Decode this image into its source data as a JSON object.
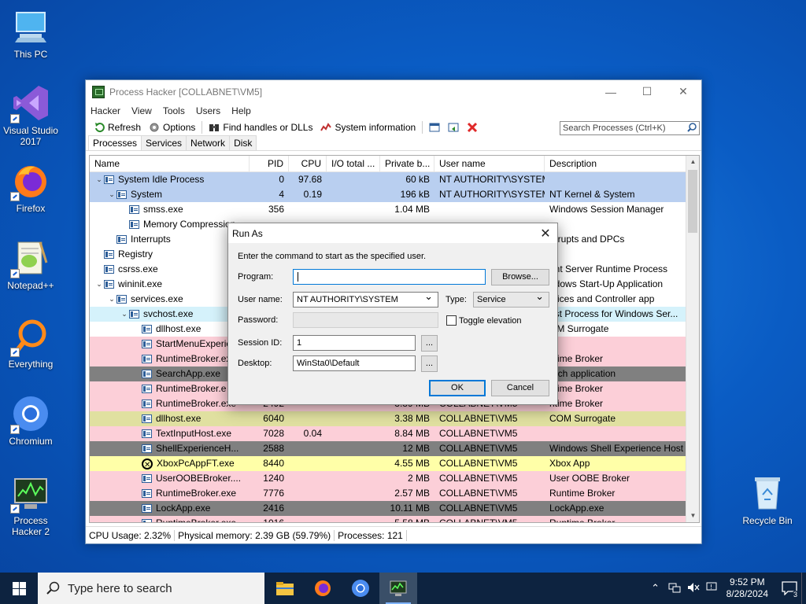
{
  "desktop": {
    "icons": [
      {
        "label": "This PC",
        "icon": "this-pc-icon"
      },
      {
        "label": "Visual Studio 2017",
        "icon": "visual-studio-icon"
      },
      {
        "label": "Firefox",
        "icon": "firefox-icon"
      },
      {
        "label": "Notepad++",
        "icon": "notepadpp-icon"
      },
      {
        "label": "Everything",
        "icon": "everything-icon"
      },
      {
        "label": "Chromium",
        "icon": "chromium-icon"
      },
      {
        "label": "Process Hacker 2",
        "icon": "process-hacker-icon"
      },
      {
        "label": "Recycle Bin",
        "icon": "recycle-bin-icon"
      }
    ]
  },
  "window": {
    "title": "Process Hacker [COLLABNET\\VM5]",
    "menu": [
      "Hacker",
      "View",
      "Tools",
      "Users",
      "Help"
    ],
    "toolbar": {
      "refresh": "Refresh",
      "options": "Options",
      "find_handles": "Find handles or DLLs",
      "system_info": "System information",
      "search_placeholder": "Search Processes (Ctrl+K)"
    },
    "tabs": [
      "Processes",
      "Services",
      "Network",
      "Disk"
    ],
    "columns": {
      "name": "Name",
      "pid": "PID",
      "cpu": "CPU",
      "io": "I/O total ...",
      "private": "Private b...",
      "user": "User name",
      "desc": "Description"
    },
    "rows": [
      {
        "name": "System Idle Process",
        "pid": "0",
        "cpu": "97.68",
        "io": "",
        "private": "60 kB",
        "user": "NT AUTHORITY\\SYSTEM",
        "desc": "",
        "indent": 0,
        "exp": "⌄",
        "bg": "blue"
      },
      {
        "name": "System",
        "pid": "4",
        "cpu": "0.19",
        "io": "",
        "private": "196 kB",
        "user": "NT AUTHORITY\\SYSTEM",
        "desc": "NT Kernel & System",
        "indent": 1,
        "exp": "⌄",
        "bg": "blue"
      },
      {
        "name": "smss.exe",
        "pid": "356",
        "cpu": "",
        "io": "",
        "private": "1.04 MB",
        "user": "",
        "desc": "Windows Session Manager",
        "indent": 2,
        "exp": "",
        "bg": ""
      },
      {
        "name": "Memory Compression",
        "pid": "",
        "cpu": "",
        "io": "",
        "private": "",
        "user": "",
        "desc": "",
        "indent": 2,
        "exp": "",
        "bg": ""
      },
      {
        "name": "Interrupts",
        "pid": "",
        "cpu": "",
        "io": "",
        "private": "",
        "user": "",
        "desc": "errupts and DPCs",
        "indent": 1,
        "exp": "",
        "bg": ""
      },
      {
        "name": "Registry",
        "pid": "",
        "cpu": "",
        "io": "",
        "private": "",
        "user": "",
        "desc": "",
        "indent": 0,
        "exp": "",
        "bg": ""
      },
      {
        "name": "csrss.exe",
        "pid": "",
        "cpu": "",
        "io": "",
        "private": "",
        "user": "",
        "desc": "ent Server Runtime Process",
        "indent": 0,
        "exp": "",
        "bg": ""
      },
      {
        "name": "wininit.exe",
        "pid": "",
        "cpu": "",
        "io": "",
        "private": "",
        "user": "",
        "desc": "ndows Start-Up Application",
        "indent": 0,
        "exp": "⌄",
        "bg": ""
      },
      {
        "name": "services.exe",
        "pid": "",
        "cpu": "",
        "io": "",
        "private": "",
        "user": "",
        "desc": "rvices and Controller app",
        "indent": 1,
        "exp": "⌄",
        "bg": ""
      },
      {
        "name": "svchost.exe",
        "pid": "",
        "cpu": "",
        "io": "",
        "private": "",
        "user": "",
        "desc": "ost Process for Windows Ser...",
        "indent": 2,
        "exp": "⌄",
        "bg": "cyan"
      },
      {
        "name": "dllhost.exe",
        "pid": "",
        "cpu": "",
        "io": "",
        "private": "",
        "user": "",
        "desc": "OM Surrogate",
        "indent": 3,
        "exp": "",
        "bg": ""
      },
      {
        "name": "StartMenuExperie",
        "pid": "",
        "cpu": "",
        "io": "",
        "private": "",
        "user": "",
        "desc": "",
        "indent": 3,
        "exp": "",
        "bg": "pink"
      },
      {
        "name": "RuntimeBroker.ex",
        "pid": "",
        "cpu": "",
        "io": "",
        "private": "",
        "user": "",
        "desc": "ntime Broker",
        "indent": 3,
        "exp": "",
        "bg": "pink"
      },
      {
        "name": "SearchApp.exe",
        "pid": "",
        "cpu": "",
        "io": "",
        "private": "",
        "user": "",
        "desc": "arch application",
        "indent": 3,
        "exp": "",
        "bg": "dark"
      },
      {
        "name": "RuntimeBroker.e",
        "pid": "",
        "cpu": "",
        "io": "",
        "private": "",
        "user": "",
        "desc": "ntime Broker",
        "indent": 3,
        "exp": "",
        "bg": "pink"
      },
      {
        "name": "RuntimeBroker.exe",
        "pid": "2492",
        "cpu": "",
        "io": "",
        "private": "3.89 MB",
        "user": "COLLABNET\\VM5",
        "desc": "ntime Broker",
        "indent": 3,
        "exp": "",
        "bg": "pink"
      },
      {
        "name": "dllhost.exe",
        "pid": "6040",
        "cpu": "",
        "io": "",
        "private": "3.38 MB",
        "user": "COLLABNET\\VM5",
        "desc": "COM Surrogate",
        "indent": 3,
        "exp": "",
        "bg": "olive"
      },
      {
        "name": "TextInputHost.exe",
        "pid": "7028",
        "cpu": "0.04",
        "io": "",
        "private": "8.84 MB",
        "user": "COLLABNET\\VM5",
        "desc": "",
        "indent": 3,
        "exp": "",
        "bg": "pink"
      },
      {
        "name": "ShellExperienceH...",
        "pid": "2588",
        "cpu": "",
        "io": "",
        "private": "12 MB",
        "user": "COLLABNET\\VM5",
        "desc": "Windows Shell Experience Host",
        "indent": 3,
        "exp": "",
        "bg": "dark"
      },
      {
        "name": "XboxPcAppFT.exe",
        "pid": "8440",
        "cpu": "",
        "io": "",
        "private": "4.55 MB",
        "user": "COLLABNET\\VM5",
        "desc": "Xbox App",
        "indent": 3,
        "exp": "",
        "bg": "yellow",
        "icon": "xbox"
      },
      {
        "name": "UserOOBEBroker....",
        "pid": "1240",
        "cpu": "",
        "io": "",
        "private": "2 MB",
        "user": "COLLABNET\\VM5",
        "desc": "User OOBE Broker",
        "indent": 3,
        "exp": "",
        "bg": "pink"
      },
      {
        "name": "RuntimeBroker.exe",
        "pid": "7776",
        "cpu": "",
        "io": "",
        "private": "2.57 MB",
        "user": "COLLABNET\\VM5",
        "desc": "Runtime Broker",
        "indent": 3,
        "exp": "",
        "bg": "pink"
      },
      {
        "name": "LockApp.exe",
        "pid": "2416",
        "cpu": "",
        "io": "",
        "private": "10.11 MB",
        "user": "COLLABNET\\VM5",
        "desc": "LockApp.exe",
        "indent": 3,
        "exp": "",
        "bg": "dark"
      },
      {
        "name": "RuntimeBroker.exe",
        "pid": "1016",
        "cpu": "",
        "io": "",
        "private": "5.58 MB",
        "user": "COLLABNET\\VM5",
        "desc": "Runtime Broker",
        "indent": 3,
        "exp": "",
        "bg": "pink"
      }
    ],
    "status": {
      "cpu": "CPU Usage: 2.32%",
      "memory": "Physical memory: 2.39 GB (59.79%)",
      "processes": "Processes: 121"
    }
  },
  "dialog": {
    "title": "Run As",
    "instruction": "Enter the command to start as the specified user.",
    "program_label": "Program:",
    "program_value": "",
    "browse": "Browse...",
    "username_label": "User name:",
    "username_value": "NT AUTHORITY\\SYSTEM",
    "type_label": "Type:",
    "type_value": "Service",
    "password_label": "Password:",
    "toggle_elevation": "Toggle elevation",
    "session_label": "Session ID:",
    "session_value": "1",
    "desktop_label": "Desktop:",
    "desktop_value": "WinSta0\\Default",
    "ellipsis": "...",
    "ok": "OK",
    "cancel": "Cancel"
  },
  "taskbar": {
    "search_placeholder": "Type here to search",
    "time": "9:52 PM",
    "date": "8/28/2024",
    "notifications": "3"
  }
}
